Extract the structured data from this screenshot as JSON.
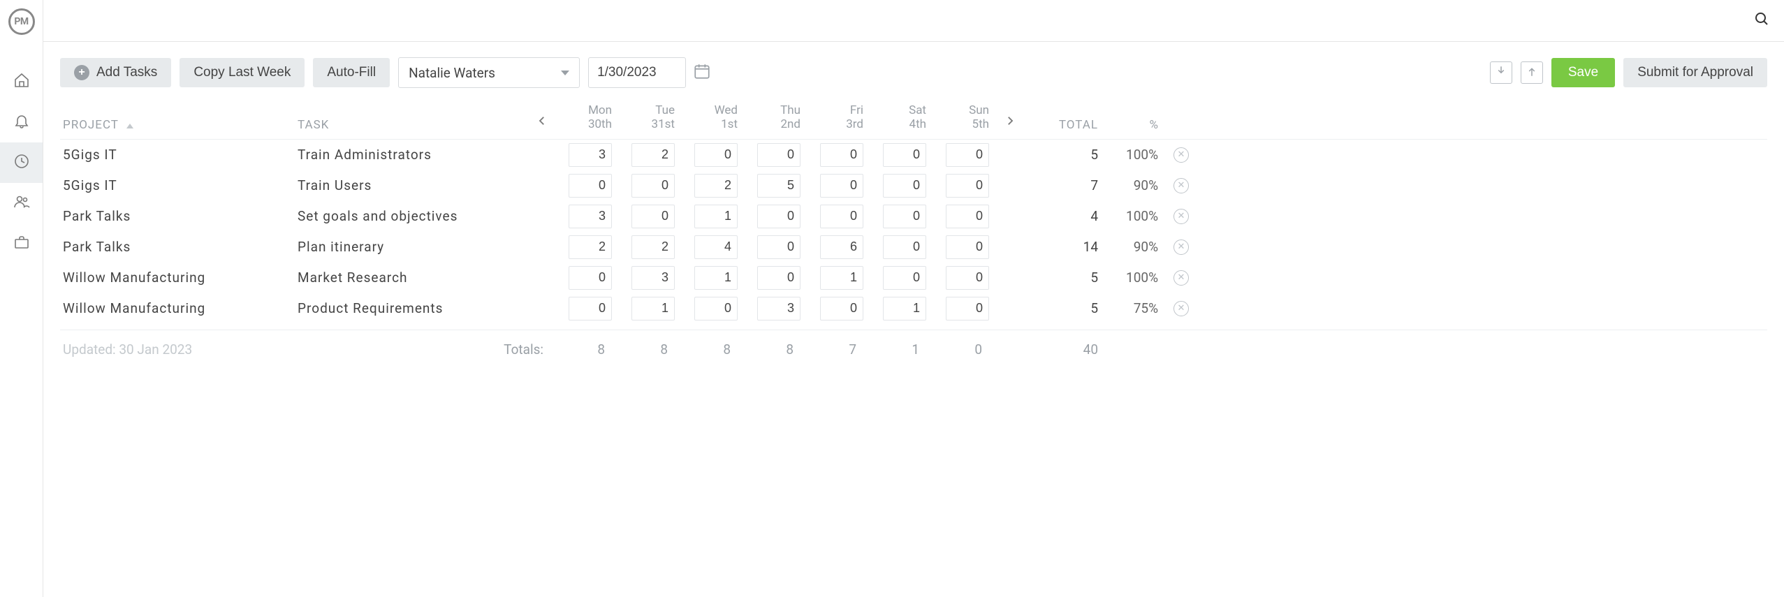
{
  "logo_text": "PM",
  "toolbar": {
    "add_tasks": "Add Tasks",
    "copy_last_week": "Copy Last Week",
    "auto_fill": "Auto-Fill",
    "user_selected": "Natalie Waters",
    "date": "1/30/2023",
    "save": "Save",
    "submit": "Submit for Approval"
  },
  "columns": {
    "project": "PROJECT",
    "task": "TASK",
    "total": "TOTAL",
    "percent": "%"
  },
  "days": [
    {
      "dow": "Mon",
      "dnum": "30th"
    },
    {
      "dow": "Tue",
      "dnum": "31st"
    },
    {
      "dow": "Wed",
      "dnum": "1st"
    },
    {
      "dow": "Thu",
      "dnum": "2nd"
    },
    {
      "dow": "Fri",
      "dnum": "3rd"
    },
    {
      "dow": "Sat",
      "dnum": "4th"
    },
    {
      "dow": "Sun",
      "dnum": "5th"
    }
  ],
  "rows": [
    {
      "project": "5Gigs IT",
      "task": "Train Administrators",
      "hours": [
        "3",
        "2",
        "0",
        "0",
        "0",
        "0",
        "0"
      ],
      "total": "5",
      "pct": "100%"
    },
    {
      "project": "5Gigs IT",
      "task": "Train Users",
      "hours": [
        "0",
        "0",
        "2",
        "5",
        "0",
        "0",
        "0"
      ],
      "total": "7",
      "pct": "90%"
    },
    {
      "project": "Park Talks",
      "task": "Set goals and objectives",
      "hours": [
        "3",
        "0",
        "1",
        "0",
        "0",
        "0",
        "0"
      ],
      "total": "4",
      "pct": "100%"
    },
    {
      "project": "Park Talks",
      "task": "Plan itinerary",
      "hours": [
        "2",
        "2",
        "4",
        "0",
        "6",
        "0",
        "0"
      ],
      "total": "14",
      "pct": "90%"
    },
    {
      "project": "Willow Manufacturing",
      "task": "Market Research",
      "hours": [
        "0",
        "3",
        "1",
        "0",
        "1",
        "0",
        "0"
      ],
      "total": "5",
      "pct": "100%"
    },
    {
      "project": "Willow Manufacturing",
      "task": "Product Requirements",
      "hours": [
        "0",
        "1",
        "0",
        "3",
        "0",
        "1",
        "0"
      ],
      "total": "5",
      "pct": "75%"
    }
  ],
  "totals": {
    "label": "Totals:",
    "values": [
      "8",
      "8",
      "8",
      "8",
      "7",
      "1",
      "0"
    ],
    "grand": "40"
  },
  "updated": "Updated: 30 Jan 2023"
}
